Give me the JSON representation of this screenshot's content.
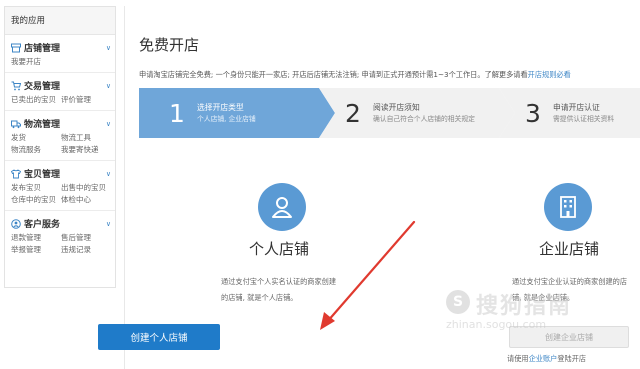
{
  "sidebar": {
    "title": "我的应用",
    "groups": [
      {
        "title": "店铺管理",
        "icon": "store-icon",
        "links": [
          "我要开店"
        ]
      },
      {
        "title": "交易管理",
        "icon": "cart-icon",
        "links": [
          "已卖出的宝贝",
          "评价管理"
        ]
      },
      {
        "title": "物流管理",
        "icon": "truck-icon",
        "links": [
          "发货",
          "物流工具",
          "物流服务",
          "我要寄快递"
        ]
      },
      {
        "title": "宝贝管理",
        "icon": "shirt-icon",
        "links": [
          "发布宝贝",
          "出售中的宝贝",
          "仓库中的宝贝",
          "体检中心"
        ]
      },
      {
        "title": "客户服务",
        "icon": "support-icon",
        "links": [
          "退款管理",
          "售后管理",
          "举报管理",
          "违规记录"
        ]
      }
    ]
  },
  "main": {
    "title": "免费开店",
    "notice_text": "申请淘宝店铺完全免费; 一个身份只能开一家店; 开店后店铺无法注销; 申请到正式开通预计需1~3个工作日。了解更多请看",
    "notice_link": "开店规则必看",
    "steps": [
      {
        "num": "1",
        "title": "选择开店类型",
        "desc": "个人店铺, 企业店铺"
      },
      {
        "num": "2",
        "title": "阅读开店须知",
        "desc": "确认自己符合个人店铺的相关规定"
      },
      {
        "num": "3",
        "title": "申请开店认证",
        "desc": "需提供认证相关资料"
      }
    ],
    "personal": {
      "title": "个人店铺",
      "desc1": "通过支付宝个人实名认证的商家创建",
      "desc2": "的店铺, 就是个人店铺。",
      "button": "创建个人店铺"
    },
    "company": {
      "title": "企业店铺",
      "desc1": "通过支付宝企业认证的商家创建的店",
      "desc2": "铺, 就是企业店铺。",
      "button": "创建企业店铺",
      "login_prefix": "请使用",
      "login_link": "企业账户",
      "login_suffix": "登陆开店"
    }
  },
  "watermark": {
    "symbol": "S",
    "text": "搜狗指南",
    "url": "zhinan.sogou.com"
  },
  "colors": {
    "accent": "#1f7bc9",
    "step_active": "#6fa6d9",
    "icon_bg": "#5a9ad4",
    "arrow": "#e03a2f"
  }
}
